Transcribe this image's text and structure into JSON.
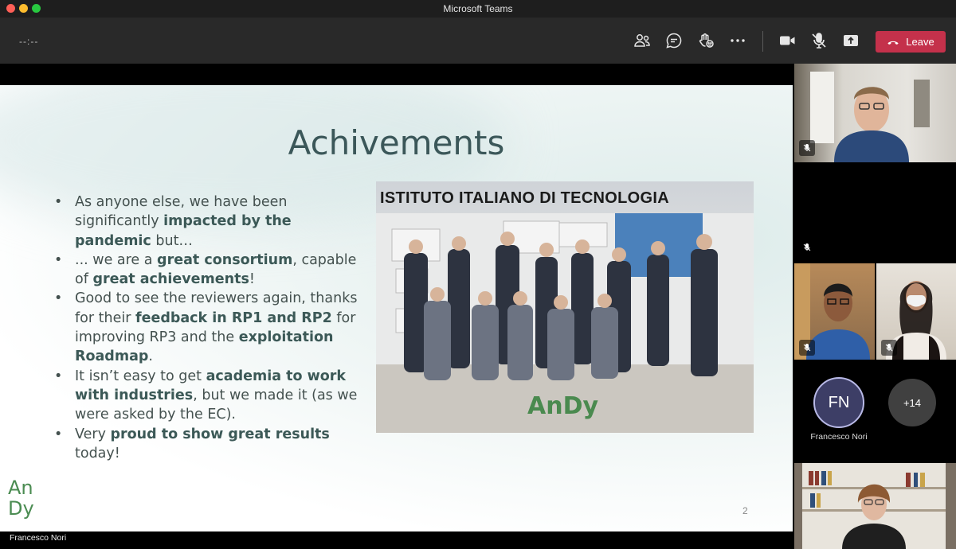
{
  "window": {
    "title": "Microsoft Teams"
  },
  "toolbar": {
    "timer": "--:--",
    "icons": [
      "people-icon",
      "chat-icon",
      "reactions-icon",
      "more-icon",
      "camera-icon",
      "mic-off-icon",
      "share-icon"
    ],
    "leave_label": "Leave",
    "leave_color": "#c4314b"
  },
  "slide": {
    "title": "Achivements",
    "bullets": [
      {
        "pre1": "As anyone else, we have been significantly ",
        "b1": "impacted by the pandemic",
        "post1": " but…"
      },
      {
        "pre1": "... we are a ",
        "b1": "great consortium",
        "post1": ", capable of ",
        "b2": "great achievements",
        "post2": "!"
      },
      {
        "pre1": "Good to see the reviewers again, thanks for their ",
        "b1": "feedback in RP1 and RP2",
        "post1": "  for improving RP3 and the ",
        "b2": "exploitation Roadmap",
        "post2": "."
      },
      {
        "pre1": "It isn’t easy to get ",
        "b1": "academia to work with industries",
        "post1": ", but we made it (as we were asked by the EC)."
      },
      {
        "pre1": "Very ",
        "b1": "proud to show great results",
        "post1": " today!"
      }
    ],
    "photo_heading": "ISTITUTO ITALIANO DI TECNOLOGIA",
    "photo_logo_text": "AnDy",
    "page_number": "2",
    "logo_text": "AnDy",
    "accent_color": "#3b5759"
  },
  "presenter": {
    "name": "Francesco Nori"
  },
  "participants": {
    "fn_initials": "FN",
    "fn_name": "Francesco Nori",
    "more_count": "+14"
  }
}
